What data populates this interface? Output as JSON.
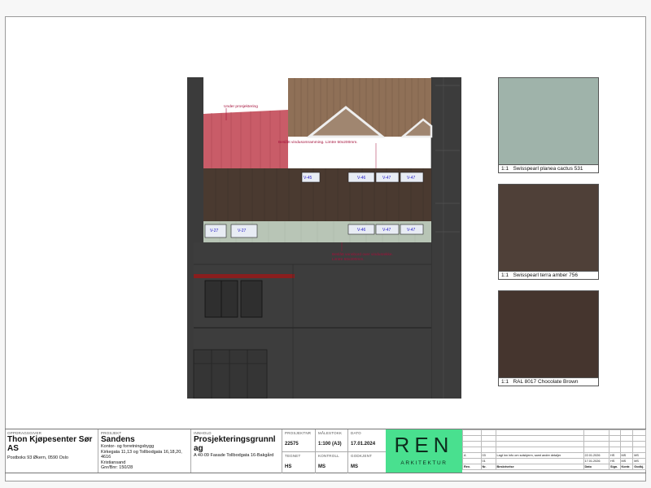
{
  "drawing": {
    "annotations": {
      "under_prosjektering": "Under prosjektering",
      "beslatt_vinduomramming": "Beslått vindusomramming. Limtre 50x200mm.",
      "beslatt_vannbord": "Beslått vannbord over vindusrekke.",
      "limtre": "Limtre 50x200mm."
    },
    "windows_upper": [
      "V-45",
      "V-46",
      "V-47",
      "V-47"
    ],
    "windows_lower": [
      "V-27",
      "V-27",
      "V-46",
      "V-47",
      "V-47"
    ]
  },
  "swatches": [
    {
      "scale": "1:1",
      "name": "Swisspearl planea cactus 531",
      "color": "#9fb3aa"
    },
    {
      "scale": "1:1",
      "name": "Swisspearl terra amber 756",
      "color": "#4f4038"
    },
    {
      "scale": "1:1",
      "name": "RAL 8017 Chocolate Brown",
      "color": "#45352e"
    }
  ],
  "titleblock": {
    "oppdragsgiver_label": "OPPDRAGSGIVER",
    "oppdragsgiver": "Thon Kjøpesenter Sør AS",
    "oppdragsgiver_addr": "Postboks 93 Økern, 0590 Oslo",
    "prosjekt_label": "PROSJEKT",
    "prosjekt": "Sandens",
    "prosjekt_l1": "Kontor- og forretningsbygg",
    "prosjekt_l2": "Kirkegata 11,13 og Tollbodgata 16,18,20, 4616",
    "prosjekt_l3": "Kristiansand",
    "prosjekt_l4": "Gnr/Bnr: 150/28",
    "innhold_label": "INNHOLD",
    "innhold": "Prosjekteringsgrunnlag",
    "innhold_sub": "A 40-09 Fasade Tollbodgata 16-Bakgård",
    "prosjektnr_label": "PROSJEKTNR",
    "prosjektnr": "22575",
    "malestokk_label": "MÅLESTOKK",
    "malestokk": "1:100 (A3)",
    "dato_label": "DATO",
    "dato": "17.01.2024",
    "tegnet_label": "TEGNET",
    "tegnet": "HS",
    "kontroll_label": "KONTROLL",
    "kontroll": "MS",
    "godkjent_label": "GODKJENT",
    "godkjent": "MS",
    "logo": "REN",
    "logo_sub": "ARKITEKTUR"
  },
  "revisions": {
    "rows": [
      {
        "rev": "A",
        "nr": "03",
        "desc": "Lagt inn info om solskjerm, samt andre detaljer",
        "date": "22.01.2026",
        "sign": "HS",
        "kontr": "MS",
        "godkj": "MS"
      },
      {
        "rev": "",
        "nr": "01",
        "desc": "",
        "date": "17.01.2026",
        "sign": "HS",
        "kontr": "MS",
        "godkj": "MS"
      }
    ],
    "headers": {
      "rev": "Rev.",
      "nr": "Nr.",
      "desc": "Beskrivelse",
      "date": "Dato",
      "sign": "Sign.",
      "kontr": "Kontr.",
      "godkj": "Godkj."
    }
  }
}
